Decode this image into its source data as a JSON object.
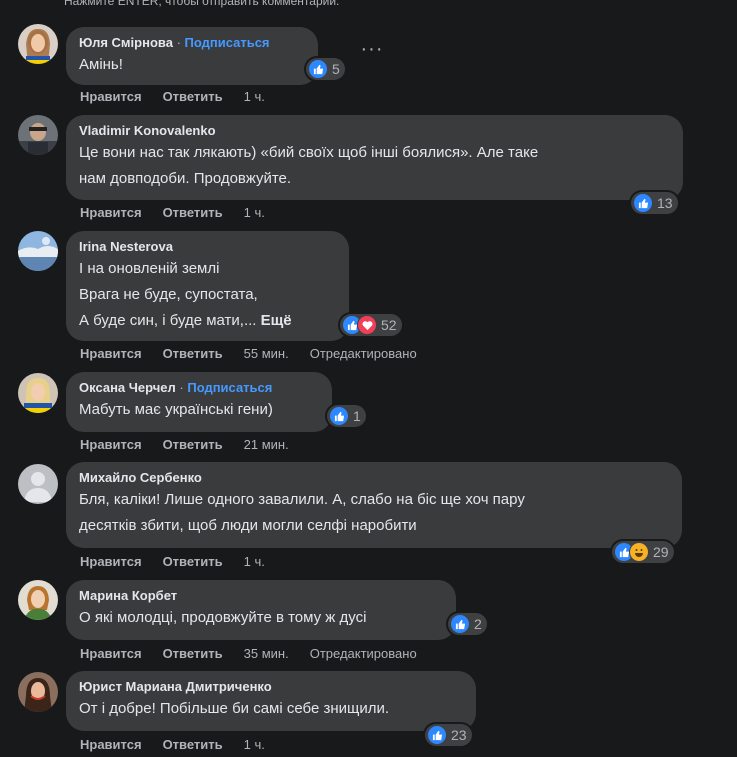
{
  "hint": "Нажмите ENTER, чтобы отправить комментарий.",
  "actions": {
    "like": "Нравится",
    "reply": "Ответить",
    "edited": "Отредактировано"
  },
  "comments": [
    {
      "author": "Юля Смірнова",
      "dot": " · ",
      "follow": "Подписаться",
      "lines": [
        "Амінь!"
      ],
      "reactions": [
        "like"
      ],
      "count": "5",
      "time": "1 ч."
    },
    {
      "author": "Vladimir Konovalenko",
      "lines": [
        "Це вони нас так лякають) «бий своїх щоб інші боялися». Але таке",
        "нам довподоби. Продовжуйте."
      ],
      "reactions": [
        "like"
      ],
      "count": "13",
      "time": "1 ч."
    },
    {
      "author": "Irina Nesterova",
      "lines": [
        "І на оновленій землі",
        "Врага не буде, супостата,",
        "А буде син, і буде мати,..."
      ],
      "more": "Ещё",
      "reactions": [
        "like",
        "love"
      ],
      "count": "52",
      "time": "55 мин.",
      "edited": true
    },
    {
      "author": "Оксана Черчел",
      "dot": " · ",
      "follow": "Подписаться",
      "lines": [
        "Мабуть має українські гени)"
      ],
      "reactions": [
        "like"
      ],
      "count": "1",
      "time": "21 мин."
    },
    {
      "author": "Михайло Сербенко",
      "lines": [
        "Бля, каліки! Лише одного завалили. А, слабо на біс ще хоч пару",
        "десятків збити, щоб люди могли селфі наробити"
      ],
      "reactions": [
        "like",
        "haha"
      ],
      "count": "29",
      "time": "1 ч."
    },
    {
      "author": "Марина Корбет",
      "lines": [
        "О які молодці, продовжуйте в тому ж дусі"
      ],
      "reactions": [
        "like"
      ],
      "count": "2",
      "time": "35 мин.",
      "edited": true
    },
    {
      "author": "Юрист Мариана Дмитриченко",
      "lines": [
        "От і добре! Побільше би самі себе знищили."
      ],
      "reactions": [
        "like"
      ],
      "count": "23",
      "time": "1 ч."
    }
  ]
}
